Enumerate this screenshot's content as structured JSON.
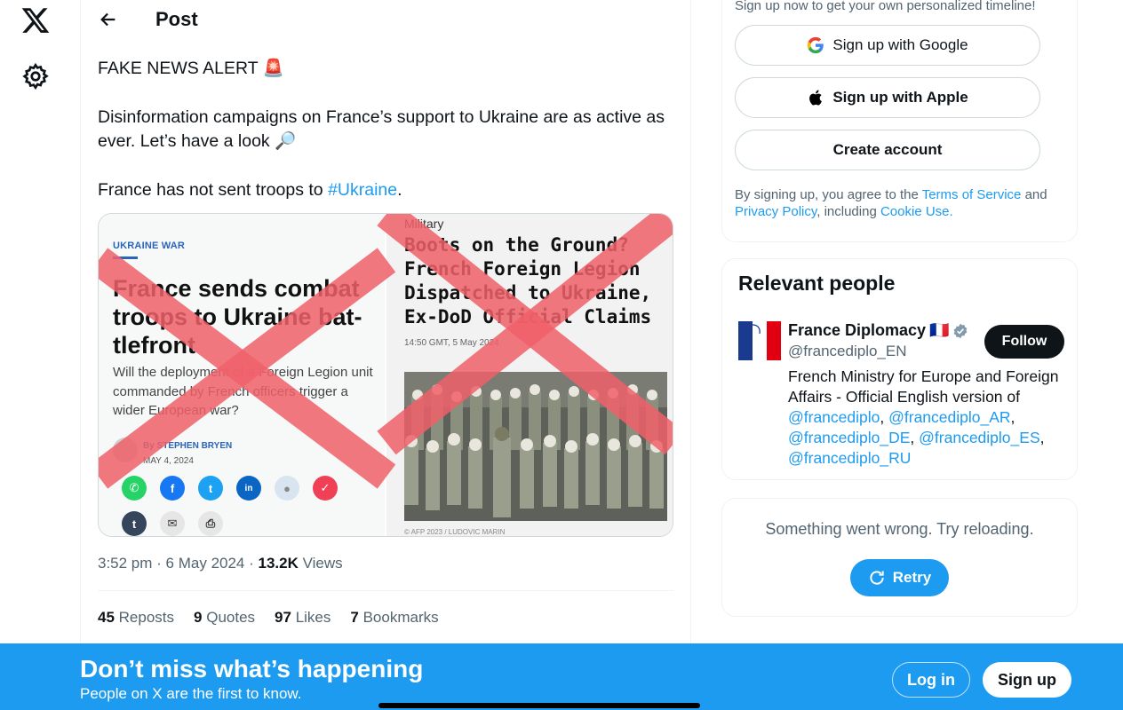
{
  "header": {
    "title": "Post"
  },
  "post": {
    "line1": "FAKE NEWS ALERT",
    "line1_emoji": "🚨",
    "line2": "Disinformation campaigns on France’s support to Ukraine are as active as ever. Let’s have a look",
    "line2_emoji": "🔎",
    "line3_prefix": "France has not sent troops to ",
    "line3_hashtag": "#Ukraine",
    "line3_suffix": ".",
    "time": "3:52 pm",
    "date": "6 May 2024",
    "views_count": "13.2K",
    "views_label": "Views",
    "stats": [
      {
        "count": "45",
        "label": "Reposts"
      },
      {
        "count": "9",
        "label": "Quotes"
      },
      {
        "count": "97",
        "label": "Likes"
      },
      {
        "count": "7",
        "label": "Bookmarks"
      }
    ]
  },
  "media": {
    "left": {
      "tag": "UKRAINE WAR",
      "headline": "France sends combat troops to Ukraine bat-tlefront",
      "deck": "Will the deployment of a Foreign Legion unit commanded by French officers trigger a wider European war?",
      "author": "By STEPHEN BRYEN",
      "date": "MAY 4, 2024",
      "share_icons": [
        "whatsapp-icon",
        "facebook-icon",
        "twitter-icon",
        "linkedin-icon",
        "reddit-icon",
        "pocket-icon",
        "tumblr-icon",
        "mail-icon",
        "print-icon"
      ]
    },
    "right": {
      "tag": "Military",
      "headline": "Boots on the Ground? French Foreign Legion Dispatched to Ukraine, Ex-DoD Official Claims",
      "time": "14:50 GMT, 5 May 2024",
      "credit": "© AFP 2023 / LUDOVIC MARIN"
    },
    "overlay_color": "#f0606a"
  },
  "sidebar": {
    "signup": {
      "hint": "Sign up now to get your own personalized timeline!",
      "google_label": "Sign up with Google",
      "apple_label": "Sign up with Apple",
      "create_label": "Create account",
      "legal_prefix": "By signing up, you agree to the ",
      "terms_link": "Terms of Service",
      "legal_and": " and ",
      "privacy_link": "Privacy Policy",
      "legal_including": ", including ",
      "cookie_link": "Cookie Use."
    },
    "people": {
      "title": "Relevant people",
      "name": "France Diplomacy",
      "flag": "🇫🇷",
      "handle": "@francediplo_EN",
      "follow_label": "Follow",
      "bio_text": "French Ministry for Europe and Foreign Affairs - Official English version of ",
      "bio_links": [
        "@francediplo",
        "@francediplo_AR",
        "@francediplo_DE",
        "@francediplo_ES",
        "@francediplo_RU"
      ]
    },
    "error": {
      "message": "Something went wrong. Try reloading.",
      "retry_label": "Retry"
    }
  },
  "banner": {
    "title": "Don’t miss what’s happening",
    "subtitle": "People on X are the first to know.",
    "login_label": "Log in",
    "signup_label": "Sign up"
  },
  "colors": {
    "accent": "#1d9bf0",
    "text": "#0f1419",
    "secondary": "#536471"
  }
}
